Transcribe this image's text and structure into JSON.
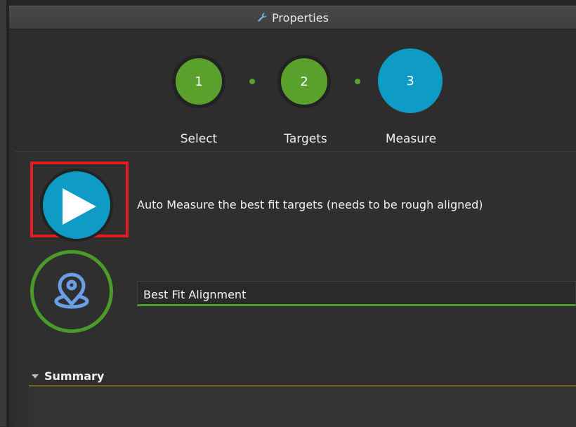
{
  "panel": {
    "title": "Properties",
    "title_icon": "wrench-icon"
  },
  "stepper": {
    "steps": [
      {
        "number": "1",
        "label": "Select",
        "state": "complete"
      },
      {
        "number": "2",
        "label": "Targets",
        "state": "complete"
      },
      {
        "number": "3",
        "label": "Measure",
        "state": "active"
      }
    ]
  },
  "actions": {
    "auto_measure": {
      "icon": "play-icon",
      "description": "Auto Measure the best fit targets (needs to be rough aligned)"
    },
    "alignment": {
      "icon": "location-pin-icon",
      "value": "Best Fit Alignment"
    }
  },
  "summary": {
    "label": "Summary"
  },
  "colors": {
    "complete": "#5aa02c",
    "active": "#0e9bc6",
    "highlight": "#e41c24",
    "divider": "#d4a21a"
  }
}
